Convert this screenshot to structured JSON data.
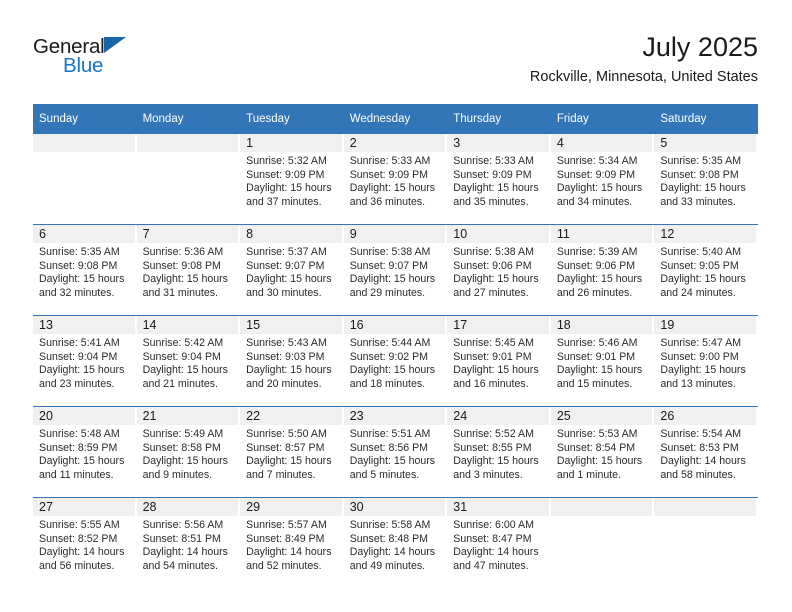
{
  "brand": {
    "name_part1": "General",
    "name_part2": "Blue",
    "accent_color": "#1875c9",
    "triangle_color": "#1767a8"
  },
  "header": {
    "title": "July 2025",
    "subtitle": "Rockville, Minnesota, United States",
    "header_bg": "#3376b8",
    "daynum_band_bg": "#f0f0f0"
  },
  "weekday_headers": [
    "Sunday",
    "Monday",
    "Tuesday",
    "Wednesday",
    "Thursday",
    "Friday",
    "Saturday"
  ],
  "labels": {
    "sunrise_prefix": "Sunrise:",
    "sunset_prefix": "Sunset:",
    "daylight_prefix": "Daylight:"
  },
  "weeks": [
    {
      "days": [
        {
          "num": "",
          "sunrise": "",
          "sunset": "",
          "daylight_line1": "",
          "daylight_line2": "",
          "empty": true
        },
        {
          "num": "",
          "sunrise": "",
          "sunset": "",
          "daylight_line1": "",
          "daylight_line2": "",
          "empty": true
        },
        {
          "num": "1",
          "sunrise": "Sunrise: 5:32 AM",
          "sunset": "Sunset: 9:09 PM",
          "daylight_line1": "Daylight: 15 hours",
          "daylight_line2": "and 37 minutes.",
          "empty": false
        },
        {
          "num": "2",
          "sunrise": "Sunrise: 5:33 AM",
          "sunset": "Sunset: 9:09 PM",
          "daylight_line1": "Daylight: 15 hours",
          "daylight_line2": "and 36 minutes.",
          "empty": false
        },
        {
          "num": "3",
          "sunrise": "Sunrise: 5:33 AM",
          "sunset": "Sunset: 9:09 PM",
          "daylight_line1": "Daylight: 15 hours",
          "daylight_line2": "and 35 minutes.",
          "empty": false
        },
        {
          "num": "4",
          "sunrise": "Sunrise: 5:34 AM",
          "sunset": "Sunset: 9:09 PM",
          "daylight_line1": "Daylight: 15 hours",
          "daylight_line2": "and 34 minutes.",
          "empty": false
        },
        {
          "num": "5",
          "sunrise": "Sunrise: 5:35 AM",
          "sunset": "Sunset: 9:08 PM",
          "daylight_line1": "Daylight: 15 hours",
          "daylight_line2": "and 33 minutes.",
          "empty": false
        }
      ]
    },
    {
      "days": [
        {
          "num": "6",
          "sunrise": "Sunrise: 5:35 AM",
          "sunset": "Sunset: 9:08 PM",
          "daylight_line1": "Daylight: 15 hours",
          "daylight_line2": "and 32 minutes.",
          "empty": false
        },
        {
          "num": "7",
          "sunrise": "Sunrise: 5:36 AM",
          "sunset": "Sunset: 9:08 PM",
          "daylight_line1": "Daylight: 15 hours",
          "daylight_line2": "and 31 minutes.",
          "empty": false
        },
        {
          "num": "8",
          "sunrise": "Sunrise: 5:37 AM",
          "sunset": "Sunset: 9:07 PM",
          "daylight_line1": "Daylight: 15 hours",
          "daylight_line2": "and 30 minutes.",
          "empty": false
        },
        {
          "num": "9",
          "sunrise": "Sunrise: 5:38 AM",
          "sunset": "Sunset: 9:07 PM",
          "daylight_line1": "Daylight: 15 hours",
          "daylight_line2": "and 29 minutes.",
          "empty": false
        },
        {
          "num": "10",
          "sunrise": "Sunrise: 5:38 AM",
          "sunset": "Sunset: 9:06 PM",
          "daylight_line1": "Daylight: 15 hours",
          "daylight_line2": "and 27 minutes.",
          "empty": false
        },
        {
          "num": "11",
          "sunrise": "Sunrise: 5:39 AM",
          "sunset": "Sunset: 9:06 PM",
          "daylight_line1": "Daylight: 15 hours",
          "daylight_line2": "and 26 minutes.",
          "empty": false
        },
        {
          "num": "12",
          "sunrise": "Sunrise: 5:40 AM",
          "sunset": "Sunset: 9:05 PM",
          "daylight_line1": "Daylight: 15 hours",
          "daylight_line2": "and 24 minutes.",
          "empty": false
        }
      ]
    },
    {
      "days": [
        {
          "num": "13",
          "sunrise": "Sunrise: 5:41 AM",
          "sunset": "Sunset: 9:04 PM",
          "daylight_line1": "Daylight: 15 hours",
          "daylight_line2": "and 23 minutes.",
          "empty": false
        },
        {
          "num": "14",
          "sunrise": "Sunrise: 5:42 AM",
          "sunset": "Sunset: 9:04 PM",
          "daylight_line1": "Daylight: 15 hours",
          "daylight_line2": "and 21 minutes.",
          "empty": false
        },
        {
          "num": "15",
          "sunrise": "Sunrise: 5:43 AM",
          "sunset": "Sunset: 9:03 PM",
          "daylight_line1": "Daylight: 15 hours",
          "daylight_line2": "and 20 minutes.",
          "empty": false
        },
        {
          "num": "16",
          "sunrise": "Sunrise: 5:44 AM",
          "sunset": "Sunset: 9:02 PM",
          "daylight_line1": "Daylight: 15 hours",
          "daylight_line2": "and 18 minutes.",
          "empty": false
        },
        {
          "num": "17",
          "sunrise": "Sunrise: 5:45 AM",
          "sunset": "Sunset: 9:01 PM",
          "daylight_line1": "Daylight: 15 hours",
          "daylight_line2": "and 16 minutes.",
          "empty": false
        },
        {
          "num": "18",
          "sunrise": "Sunrise: 5:46 AM",
          "sunset": "Sunset: 9:01 PM",
          "daylight_line1": "Daylight: 15 hours",
          "daylight_line2": "and 15 minutes.",
          "empty": false
        },
        {
          "num": "19",
          "sunrise": "Sunrise: 5:47 AM",
          "sunset": "Sunset: 9:00 PM",
          "daylight_line1": "Daylight: 15 hours",
          "daylight_line2": "and 13 minutes.",
          "empty": false
        }
      ]
    },
    {
      "days": [
        {
          "num": "20",
          "sunrise": "Sunrise: 5:48 AM",
          "sunset": "Sunset: 8:59 PM",
          "daylight_line1": "Daylight: 15 hours",
          "daylight_line2": "and 11 minutes.",
          "empty": false
        },
        {
          "num": "21",
          "sunrise": "Sunrise: 5:49 AM",
          "sunset": "Sunset: 8:58 PM",
          "daylight_line1": "Daylight: 15 hours",
          "daylight_line2": "and 9 minutes.",
          "empty": false
        },
        {
          "num": "22",
          "sunrise": "Sunrise: 5:50 AM",
          "sunset": "Sunset: 8:57 PM",
          "daylight_line1": "Daylight: 15 hours",
          "daylight_line2": "and 7 minutes.",
          "empty": false
        },
        {
          "num": "23",
          "sunrise": "Sunrise: 5:51 AM",
          "sunset": "Sunset: 8:56 PM",
          "daylight_line1": "Daylight: 15 hours",
          "daylight_line2": "and 5 minutes.",
          "empty": false
        },
        {
          "num": "24",
          "sunrise": "Sunrise: 5:52 AM",
          "sunset": "Sunset: 8:55 PM",
          "daylight_line1": "Daylight: 15 hours",
          "daylight_line2": "and 3 minutes.",
          "empty": false
        },
        {
          "num": "25",
          "sunrise": "Sunrise: 5:53 AM",
          "sunset": "Sunset: 8:54 PM",
          "daylight_line1": "Daylight: 15 hours",
          "daylight_line2": "and 1 minute.",
          "empty": false
        },
        {
          "num": "26",
          "sunrise": "Sunrise: 5:54 AM",
          "sunset": "Sunset: 8:53 PM",
          "daylight_line1": "Daylight: 14 hours",
          "daylight_line2": "and 58 minutes.",
          "empty": false
        }
      ]
    },
    {
      "days": [
        {
          "num": "27",
          "sunrise": "Sunrise: 5:55 AM",
          "sunset": "Sunset: 8:52 PM",
          "daylight_line1": "Daylight: 14 hours",
          "daylight_line2": "and 56 minutes.",
          "empty": false
        },
        {
          "num": "28",
          "sunrise": "Sunrise: 5:56 AM",
          "sunset": "Sunset: 8:51 PM",
          "daylight_line1": "Daylight: 14 hours",
          "daylight_line2": "and 54 minutes.",
          "empty": false
        },
        {
          "num": "29",
          "sunrise": "Sunrise: 5:57 AM",
          "sunset": "Sunset: 8:49 PM",
          "daylight_line1": "Daylight: 14 hours",
          "daylight_line2": "and 52 minutes.",
          "empty": false
        },
        {
          "num": "30",
          "sunrise": "Sunrise: 5:58 AM",
          "sunset": "Sunset: 8:48 PM",
          "daylight_line1": "Daylight: 14 hours",
          "daylight_line2": "and 49 minutes.",
          "empty": false
        },
        {
          "num": "31",
          "sunrise": "Sunrise: 6:00 AM",
          "sunset": "Sunset: 8:47 PM",
          "daylight_line1": "Daylight: 14 hours",
          "daylight_line2": "and 47 minutes.",
          "empty": false
        },
        {
          "num": "",
          "sunrise": "",
          "sunset": "",
          "daylight_line1": "",
          "daylight_line2": "",
          "empty": true
        },
        {
          "num": "",
          "sunrise": "",
          "sunset": "",
          "daylight_line1": "",
          "daylight_line2": "",
          "empty": true
        }
      ]
    }
  ]
}
